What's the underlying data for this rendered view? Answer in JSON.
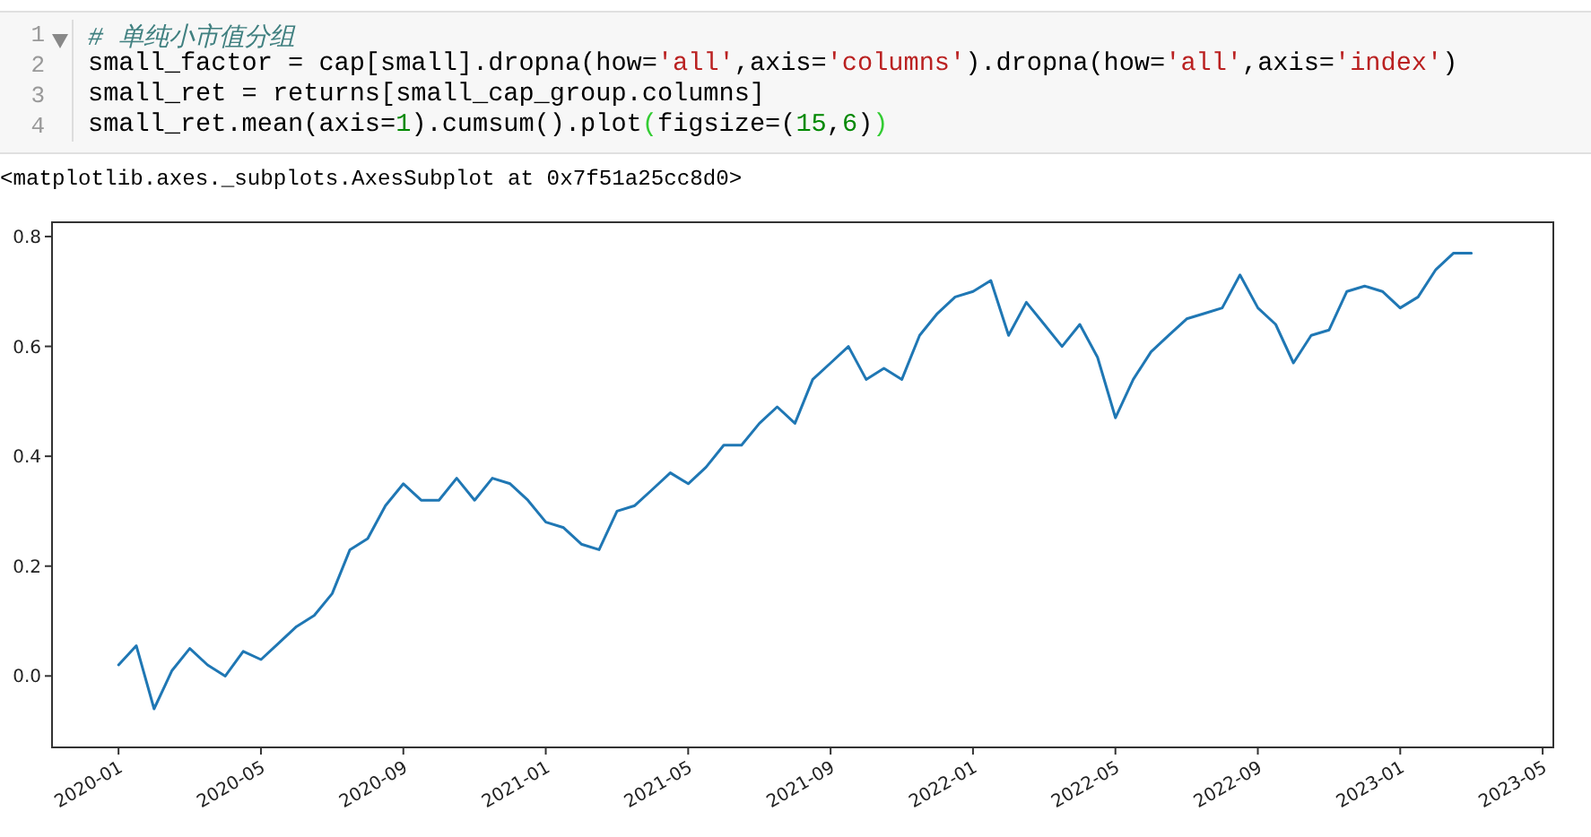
{
  "code_cell": {
    "lines": [
      {
        "number": "1",
        "fold": true,
        "tokens": [
          {
            "kind": "comment",
            "text": "# 单纯小市值分组"
          }
        ]
      },
      {
        "number": "2",
        "fold": false,
        "tokens": [
          {
            "kind": "text",
            "text": "small_factor = cap[small].dropna(how="
          },
          {
            "kind": "string",
            "text": "'all'"
          },
          {
            "kind": "text",
            "text": ",axis="
          },
          {
            "kind": "string",
            "text": "'columns'"
          },
          {
            "kind": "text",
            "text": ").dropna(how="
          },
          {
            "kind": "string",
            "text": "'all'"
          },
          {
            "kind": "text",
            "text": ",axis="
          },
          {
            "kind": "string",
            "text": "'index'"
          },
          {
            "kind": "text",
            "text": ")"
          }
        ]
      },
      {
        "number": "3",
        "fold": false,
        "tokens": [
          {
            "kind": "text",
            "text": "small_ret = returns[small_cap_group.columns]"
          }
        ]
      },
      {
        "number": "4",
        "fold": false,
        "tokens": [
          {
            "kind": "text",
            "text": "small_ret.mean(axis="
          },
          {
            "kind": "number",
            "text": "1"
          },
          {
            "kind": "text",
            "text": ").cumsum().plot"
          },
          {
            "kind": "bracket",
            "text": "("
          },
          {
            "kind": "text",
            "text": "figsize=("
          },
          {
            "kind": "number",
            "text": "15"
          },
          {
            "kind": "text",
            "text": ","
          },
          {
            "kind": "number",
            "text": "6"
          },
          {
            "kind": "text",
            "text": ")"
          },
          {
            "kind": "bracket",
            "text": ")"
          }
        ]
      }
    ]
  },
  "output_text": "<matplotlib.axes._subplots.AxesSubplot at 0x7f51a25cc8d0>",
  "chart_data": {
    "type": "line",
    "categories": [
      "2020-01",
      null,
      null,
      null,
      null,
      null,
      null,
      null,
      "2020-05",
      null,
      null,
      null,
      null,
      null,
      null,
      null,
      "2020-09",
      null,
      null,
      null,
      null,
      null,
      null,
      null,
      "2021-01",
      null,
      null,
      null,
      null,
      null,
      null,
      null,
      "2021-05",
      null,
      null,
      null,
      null,
      null,
      null,
      null,
      "2021-09",
      null,
      null,
      null,
      null,
      null,
      null,
      null,
      "2022-01",
      null,
      null,
      null,
      null,
      null,
      null,
      null,
      "2022-05",
      null,
      null,
      null,
      null,
      null,
      null,
      null,
      "2022-09",
      null,
      null,
      null,
      null,
      null,
      null,
      null,
      "2023-01",
      null,
      null,
      null,
      null,
      null,
      null,
      null,
      "2023-05"
    ],
    "series": [
      {
        "color": "#1f77b4",
        "values": [
          0.02,
          0.055,
          -0.06,
          0.01,
          0.05,
          0.02,
          0.0,
          0.045,
          0.03,
          0.06,
          0.09,
          0.11,
          0.15,
          0.23,
          0.25,
          0.31,
          0.35,
          0.32,
          0.32,
          0.36,
          0.32,
          0.36,
          0.35,
          0.32,
          0.28,
          0.27,
          0.24,
          0.23,
          0.3,
          0.31,
          0.34,
          0.37,
          0.35,
          0.38,
          0.42,
          0.42,
          0.46,
          0.49,
          0.46,
          0.54,
          0.57,
          0.6,
          0.54,
          0.56,
          0.54,
          0.62,
          0.66,
          0.69,
          0.7,
          0.72,
          0.62,
          0.68,
          0.64,
          0.6,
          0.64,
          0.58,
          0.47,
          0.54,
          0.59,
          0.62,
          0.65,
          0.66,
          0.67,
          0.73,
          0.67,
          0.64,
          0.57,
          0.62,
          0.63,
          0.7,
          0.71,
          0.7,
          0.67,
          0.69,
          0.74,
          0.77,
          0.77,
          null,
          null,
          null,
          null
        ]
      }
    ],
    "ylim": [
      -0.13,
      0.826
    ],
    "yticks": [
      {
        "value": 0,
        "label": "0.0"
      },
      {
        "value": 0.2,
        "label": "0.2"
      },
      {
        "value": 0.4,
        "label": "0.4"
      },
      {
        "value": 0.6,
        "label": "0.6"
      },
      {
        "value": 0.8,
        "label": "0.8"
      }
    ]
  }
}
